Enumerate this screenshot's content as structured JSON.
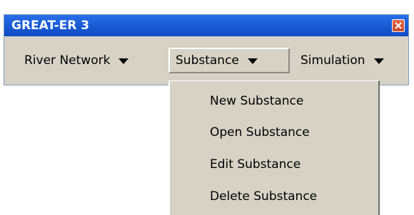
{
  "window": {
    "title": "GREAT-ER 3",
    "close_icon": "close-icon"
  },
  "menubar": {
    "items": [
      {
        "label": "River Network",
        "icon": "caret-down-icon",
        "active": false
      },
      {
        "label": "Substance",
        "icon": "caret-down-icon",
        "active": true
      },
      {
        "label": "Simulation",
        "icon": "caret-down-icon",
        "active": false
      }
    ]
  },
  "dropdown": {
    "items": [
      {
        "label": "New Substance"
      },
      {
        "label": "Open Substance"
      },
      {
        "label": "Edit Substance"
      },
      {
        "label": "Delete Substance"
      }
    ]
  },
  "colors": {
    "titlebar": "#1b5fd9",
    "menu_background": "#d6d2c6",
    "close_button": "#d1452a"
  }
}
